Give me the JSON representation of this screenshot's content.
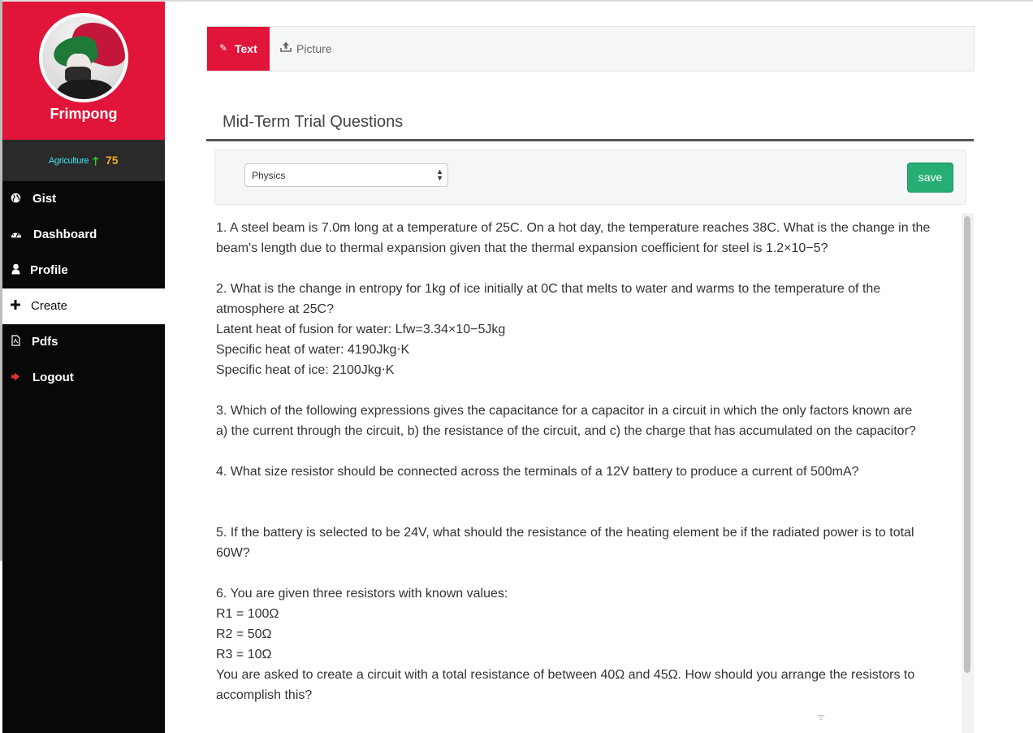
{
  "sidebar": {
    "username": "Frimpong",
    "stat": {
      "label": "Agriculture",
      "score": "75",
      "arrow_icon": "arrow-up-icon"
    },
    "nav": [
      {
        "label": "Gist",
        "icon": "globe-icon"
      },
      {
        "label": "Dashboard",
        "icon": "dashboard-icon"
      },
      {
        "label": "Profile",
        "icon": "user-icon"
      },
      {
        "label": "Create",
        "icon": "plus-icon",
        "active": true
      },
      {
        "label": "Pdfs",
        "icon": "pdf-file-icon"
      },
      {
        "label": "Logout",
        "icon": "logout-icon"
      }
    ],
    "colors": {
      "profile_bg": "#e11439",
      "nav_bg": "#080808",
      "stat_label": "#3ee4ef",
      "stat_score": "#f2a81f",
      "arrow": "#2ed12e"
    }
  },
  "tabs": [
    {
      "label": "Text",
      "icon": "pencil-icon",
      "active": true
    },
    {
      "label": "Picture",
      "icon": "upload-icon",
      "active": false
    }
  ],
  "main": {
    "title": "Mid-Term Trial Questions",
    "subject_select": {
      "value": "Physics"
    },
    "save_label": "save",
    "colors": {
      "save": "#27ae74",
      "accent": "#e11439"
    }
  },
  "questions": {
    "q1_l1": "1. A steel beam is 7.0m long at a temperature of 25C. On a hot day, the temperature reaches 38C. What is the change in the",
    "q1_l2": "beam's length due to thermal expansion given that the thermal expansion coefficient for steel is 1.2×10−5?",
    "q2_l1": "2. What is the change in entropy for 1kg of ice initially at 0C that melts to water and warms to the temperature of the",
    "q2_l2": "atmosphere at 25C?",
    "q2_l3": "Latent heat of fusion for water: Lfw=3.34×10−5Jkg",
    "q2_l4": "Specific heat of water: 4190Jkg⋅K",
    "q2_l5": "Specific heat of ice: 2100Jkg⋅K",
    "q3_l1": "3. Which of the following expressions gives the capacitance for a capacitor in a circuit in which the only factors known are",
    "q3_l2": "a) the current through the circuit, b) the resistance of the circuit, and c) the charge that has accumulated on the capacitor?",
    "q4_l1": "4. What size resistor should be connected across the terminals of a 12V battery to produce a current of 500mA?",
    "q5_l1": "5. If the battery is selected to be 24V, what should the resistance of the heating element be if the radiated power is to total",
    "q5_l2": "60W?",
    "q6_l1": "6. You are given three resistors with known values:",
    "q6_l2": "R1 = 100Ω",
    "q6_l3": "R2 = 50Ω",
    "q6_l4": "R3 = 10Ω",
    "q6_l5": "You are asked to create a circuit with a total resistance of between 40Ω and 45Ω. How should you arrange the resistors to",
    "q6_l6": "accomplish this?"
  }
}
